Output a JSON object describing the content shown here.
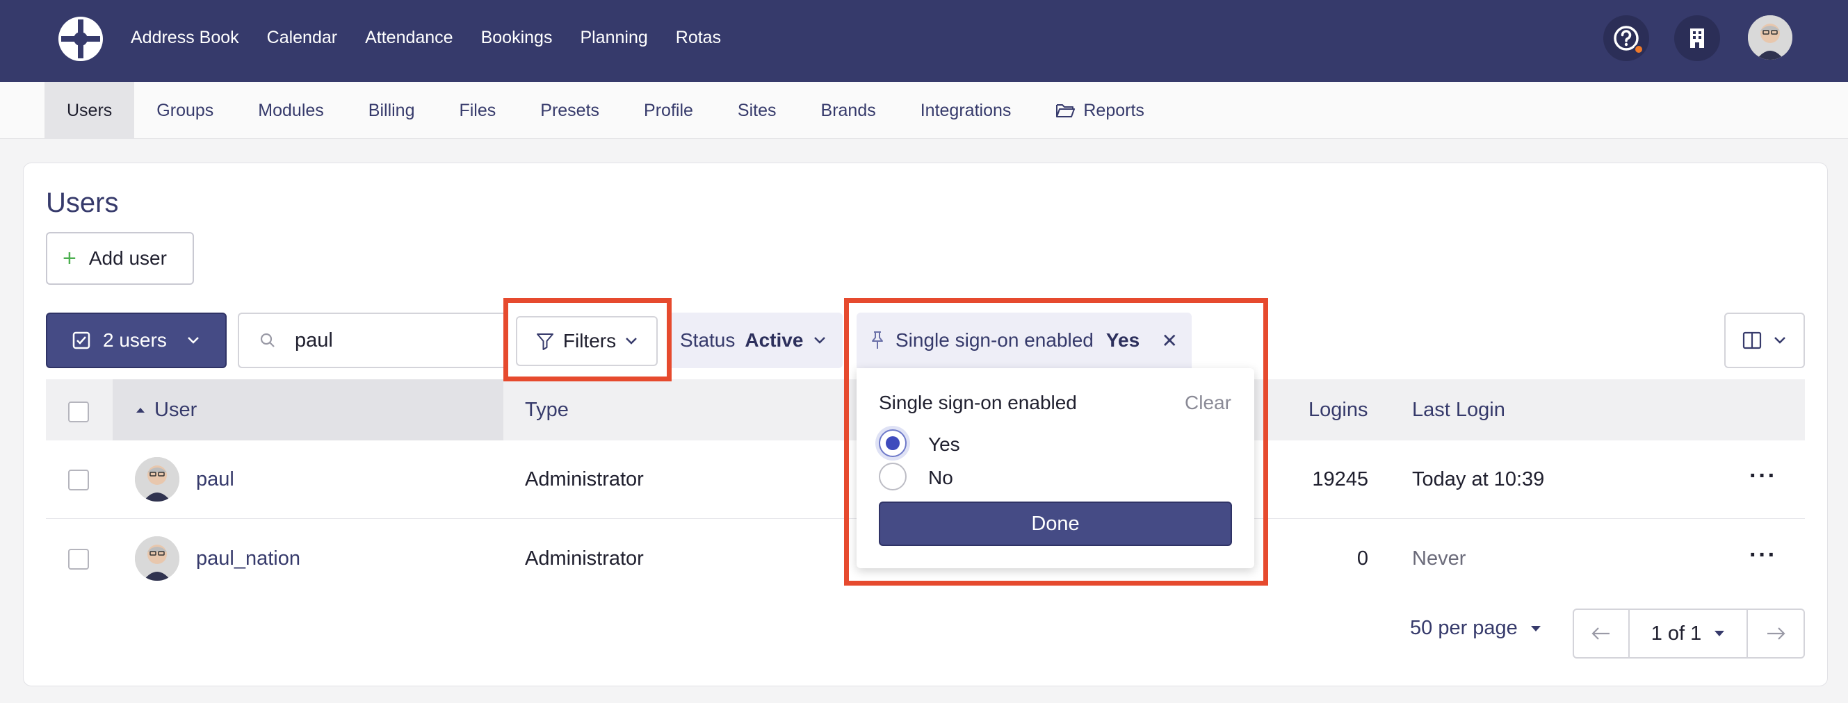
{
  "topnav": {
    "items": [
      "Address Book",
      "Calendar",
      "Attendance",
      "Bookings",
      "Planning",
      "Rotas"
    ]
  },
  "subnav": {
    "items": [
      "Users",
      "Groups",
      "Modules",
      "Billing",
      "Files",
      "Presets",
      "Profile",
      "Sites",
      "Brands",
      "Integrations",
      "Reports"
    ],
    "active": "Users"
  },
  "page": {
    "title": "Users",
    "add_user_label": "Add user"
  },
  "toolbar": {
    "selected_label": "2 users",
    "search_value": "paul",
    "filters_label": "Filters",
    "status_chip": {
      "label": "Status",
      "value": "Active"
    },
    "sso_chip": {
      "label": "Single sign-on enabled",
      "value": "Yes"
    }
  },
  "table": {
    "headers": {
      "user": "User",
      "type": "Type",
      "logins": "Logins",
      "last_login": "Last Login"
    },
    "rows": [
      {
        "user": "paul",
        "type": "Administrator",
        "logins": "19245",
        "last_login": "Today at 10:39"
      },
      {
        "user": "paul_nation",
        "type": "Administrator",
        "logins": "0",
        "last_login": "Never"
      }
    ]
  },
  "popover": {
    "title": "Single sign-on enabled",
    "clear_label": "Clear",
    "options": [
      "Yes",
      "No"
    ],
    "selected": "Yes",
    "done_label": "Done"
  },
  "pagination": {
    "per_page": "50 per page",
    "page": "1 of 1"
  },
  "colors": {
    "brand_navy": "#363a6b",
    "button_primary": "#454b85",
    "highlight_red": "#e64a2e",
    "add_icon_green": "#4caf50"
  }
}
